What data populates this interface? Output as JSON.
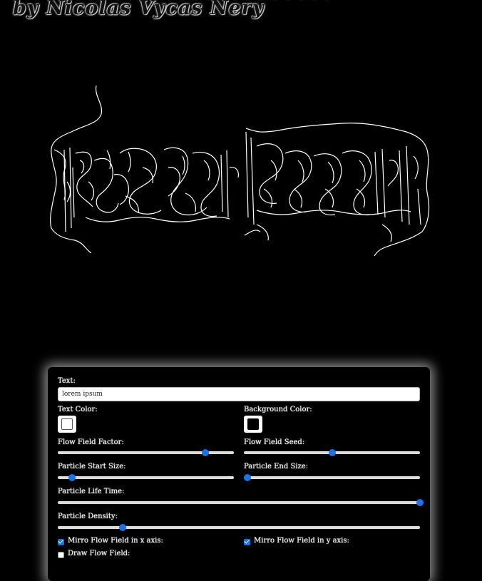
{
  "header": {
    "byline": "by Nicolas Vycas Nery"
  },
  "artwork": {
    "description_icon": "flow-field-text-art"
  },
  "controls": {
    "text_label": "Text:",
    "text_value": "lorem ipsum",
    "text_color_label": "Text Color:",
    "text_color_value": "#000000",
    "background_color_label": "Background Color:",
    "background_color_value": "#000000",
    "flow_field_factor_label": "Flow Field Factor:",
    "flow_field_factor_value": 0.84,
    "flow_field_seed_label": "Flow Field Seed:",
    "flow_field_seed_value": 0.5,
    "particle_start_size_label": "Particle Start Size:",
    "particle_start_size_value": 0.08,
    "particle_end_size_label": "Particle End Size:",
    "particle_end_size_value": 0.02,
    "particle_life_time_label": "Particle Life Time:",
    "particle_life_time_value": 1.0,
    "particle_density_label": "Particle Density:",
    "particle_density_value": 0.18,
    "mirror_x_label": "Mirro Flow Field in x axis:",
    "mirror_x_checked": true,
    "mirror_y_label": "Mirro Flow Field in y axis:",
    "mirror_y_checked": true,
    "draw_flow_field_label": "Draw Flow Field:",
    "draw_flow_field_checked": false
  },
  "colors": {
    "accent": "#1a73e8",
    "page_background": "#000000",
    "art_stroke": "#ffffff"
  }
}
